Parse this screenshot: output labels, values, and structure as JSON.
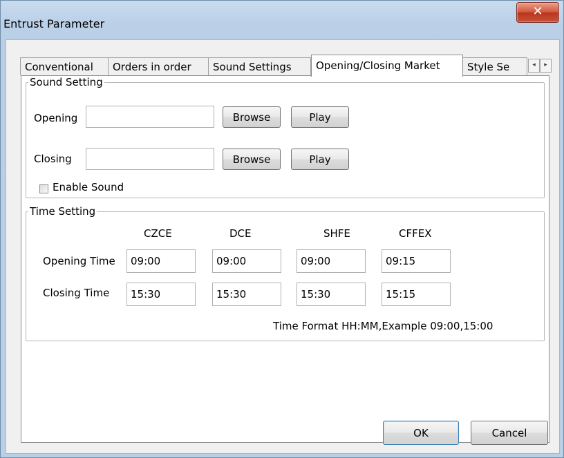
{
  "window": {
    "title": "Entrust Parameter",
    "close_glyph": "✕"
  },
  "tabs": [
    {
      "label": "Conventional"
    },
    {
      "label": "Orders in order"
    },
    {
      "label": "Sound Settings"
    },
    {
      "label": "Opening/Closing Market",
      "active": true
    },
    {
      "label": "Style Se"
    }
  ],
  "tab_scroll": {
    "left_glyph": "◂",
    "right_glyph": "▸"
  },
  "sound_setting": {
    "legend": "Sound Setting",
    "opening_label": "Opening",
    "opening_value": "",
    "closing_label": "Closing",
    "closing_value": "",
    "browse_label": "Browse",
    "play_label": "Play",
    "enable_sound_label": "Enable Sound",
    "enable_sound_checked": false
  },
  "time_setting": {
    "legend": "Time Setting",
    "exchanges": [
      "CZCE",
      "DCE",
      "SHFE",
      "CFFEX"
    ],
    "opening_time_label": "Opening Time",
    "closing_time_label": "Closing Time",
    "opening_times": [
      "09:00",
      "09:00",
      "09:00",
      "09:15"
    ],
    "closing_times": [
      "15:30",
      "15:30",
      "15:30",
      "15:15"
    ],
    "format_hint": "Time Format HH:MM,Example 09:00,15:00"
  },
  "footer": {
    "ok_label": "OK",
    "cancel_label": "Cancel"
  },
  "colors": {
    "title_bar": "#bcd1e8",
    "close_button": "#c9523a",
    "dialog_bg": "#f0f0f0"
  }
}
